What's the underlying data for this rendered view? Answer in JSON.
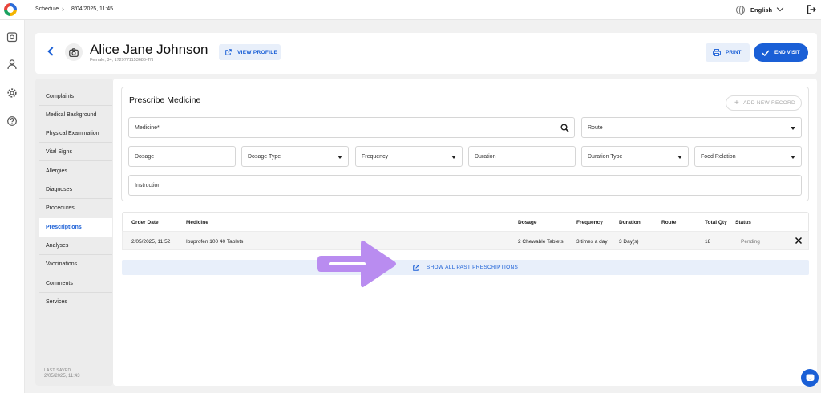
{
  "topbar": {
    "breadcrumb": [
      "Schedule",
      "8/04/2025, 11:45"
    ],
    "language": "English"
  },
  "rail": {
    "icons": [
      "calendar-icon",
      "user-icon",
      "gear-icon",
      "help-icon"
    ]
  },
  "patient": {
    "name": "Alice Jane Johnson",
    "subtitle": "Female, 34, 1729771153686-TN"
  },
  "header": {
    "view_profile_label": "VIEW PROFILE",
    "print_label": "PRINT",
    "end_visit_label": "END VISIT"
  },
  "sidebar": {
    "items": [
      {
        "label": "Complaints",
        "active": false
      },
      {
        "label": "Medical Background",
        "active": false
      },
      {
        "label": "Physical Examination",
        "active": false
      },
      {
        "label": "Vital Signs",
        "active": false
      },
      {
        "label": "Allergies",
        "active": false
      },
      {
        "label": "Diagnoses",
        "active": false
      },
      {
        "label": "Procedures",
        "active": false
      },
      {
        "label": "Prescriptions",
        "active": true
      },
      {
        "label": "Analyses",
        "active": false
      },
      {
        "label": "Vaccinations",
        "active": false
      },
      {
        "label": "Comments",
        "active": false
      },
      {
        "label": "Services",
        "active": false
      }
    ],
    "last_saved_label": "LAST SAVED",
    "last_saved_value": "2/05/2025, 11:43"
  },
  "prescribe": {
    "title": "Prescribe Medicine",
    "add_record_label": "ADD NEW RECORD",
    "fields": {
      "medicine": "Medicine*",
      "route": "Route",
      "dosage": "Dosage",
      "dosage_type": "Dosage Type",
      "frequency": "Frequency",
      "duration": "Duration",
      "duration_type": "Duration Type",
      "food_relation": "Food Relation",
      "instruction": "Instruction"
    }
  },
  "table": {
    "columns": [
      "Order Date",
      "Medicine",
      "Dosage",
      "Frequency",
      "Duration",
      "Route",
      "Total Qty",
      "Status"
    ],
    "rows": [
      {
        "order_date": "2/05/2025, 11:52",
        "medicine": "Ibuprofen 100 40 Tablets",
        "dosage": "2 Chewable Tablets",
        "frequency": "3 times a day",
        "duration": "3 Day(s)",
        "route": "",
        "total_qty": "18",
        "status": "Pending"
      }
    ]
  },
  "past_prescriptions_label": "SHOW ALL PAST PRESCRIPTIONS",
  "colors": {
    "accent": "#1a5fd6",
    "accent_light": "#e8effa",
    "annotation_arrow": "#b98cf0"
  }
}
